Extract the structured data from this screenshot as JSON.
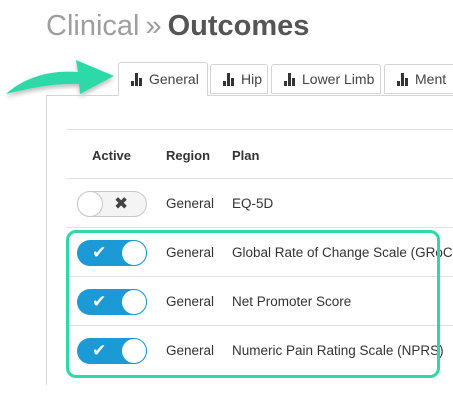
{
  "header": {
    "breadcrumb_parent": "Clinical",
    "separator": "»",
    "current": "Outcomes"
  },
  "tabs": [
    {
      "label": "General",
      "icon": "bar-chart-icon",
      "active": true
    },
    {
      "label": "Hip",
      "icon": "bar-chart-icon",
      "active": false
    },
    {
      "label": "Lower Limb",
      "icon": "bar-chart-icon",
      "active": false
    },
    {
      "label": "Ment",
      "icon": "bar-chart-icon",
      "active": false
    }
  ],
  "table": {
    "headers": [
      "Active",
      "Region",
      "Plan"
    ],
    "rows": [
      {
        "active": false,
        "region": "General",
        "plan": "EQ-5D"
      },
      {
        "active": true,
        "region": "General",
        "plan": "Global Rate of Change Scale (GRoC)"
      },
      {
        "active": true,
        "region": "General",
        "plan": "Net Promoter Score"
      },
      {
        "active": true,
        "region": "General",
        "plan": "Numeric Pain Rating Scale (NPRS)"
      }
    ]
  },
  "glyphs": {
    "off": "✖",
    "on": "✔"
  },
  "colors": {
    "toggle_on": "#1b9ad6",
    "highlight": "#2ed9a8",
    "arrow": "#2ed9a8"
  }
}
